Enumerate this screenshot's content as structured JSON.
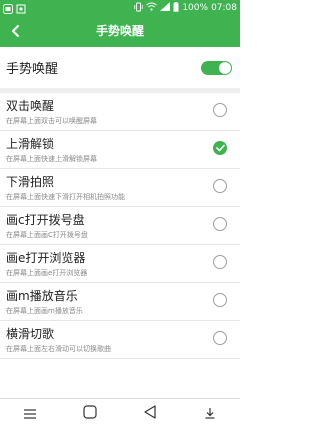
{
  "status_bar": {
    "battery": "100%",
    "time": "07:08",
    "bg_color": "#3fb34f"
  },
  "app_bar": {
    "title": "手势唤醒",
    "back_icon": "back-arrow-icon"
  },
  "master_toggle": {
    "label": "手势唤醒",
    "enabled": true
  },
  "gestures": [
    {
      "title": "双击唤醒",
      "subtitle": "在屏幕上面双击可以唤醒屏幕",
      "checked": false
    },
    {
      "title": "上滑解锁",
      "subtitle": "在屏幕上面快速上滑解锁屏幕",
      "checked": true
    },
    {
      "title": "下滑拍照",
      "subtitle": "在屏幕上面快速下滑打开相机拍照功能",
      "checked": false
    },
    {
      "title": "画c打开拨号盘",
      "subtitle": "在屏幕上面画C打开拨号盘",
      "checked": false
    },
    {
      "title": "画e打开浏览器",
      "subtitle": "在屏幕上面画e打开浏览器",
      "checked": false
    },
    {
      "title": "画m播放音乐",
      "subtitle": "在屏幕上面画m播放音乐",
      "checked": false
    },
    {
      "title": "横滑切歌",
      "subtitle": "在屏幕上面左右滑动可以切换歌曲",
      "checked": false
    }
  ],
  "accent_color": "#3fb34f"
}
